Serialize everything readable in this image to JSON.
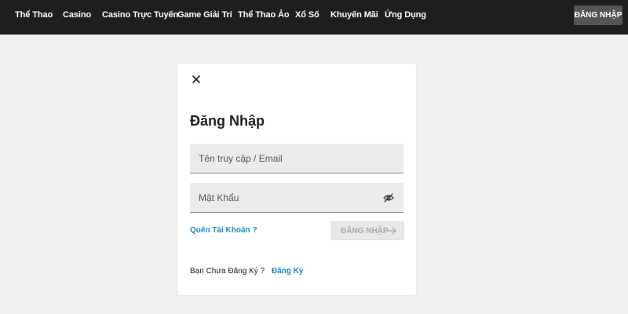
{
  "nav": {
    "items": [
      {
        "label": "Thể Thao"
      },
      {
        "label": "Casino"
      },
      {
        "label": "Casino Trực Tuyến"
      },
      {
        "label": "Game Giải Trí"
      },
      {
        "label": "Thể Thao Ảo"
      },
      {
        "label": "Xổ Số"
      },
      {
        "label": "Khuyến Mãi"
      },
      {
        "label": "Ứng Dụng"
      }
    ],
    "login_label": "ĐĂNG NHẬP"
  },
  "modal": {
    "title": "Đăng Nhập",
    "username_placeholder": "Tên truy cập / Email",
    "username_value": "",
    "password_placeholder": "Mật Khẩu",
    "password_value": "",
    "forgot_label": "Quên Tài Khoản ?",
    "submit_label": "ĐĂNG NHẬP",
    "register_prompt": "Bạn Chưa Đăng Ký ?",
    "register_label": "Đăng Ký"
  },
  "icons": {
    "close": "close-icon",
    "password_toggle": "eye-slash-icon",
    "submit_arrow": "arrow-right-icon"
  },
  "colors": {
    "topbar": "#1e1e1e",
    "link": "#1a8cc7",
    "page_background": "#f0f0f0"
  }
}
